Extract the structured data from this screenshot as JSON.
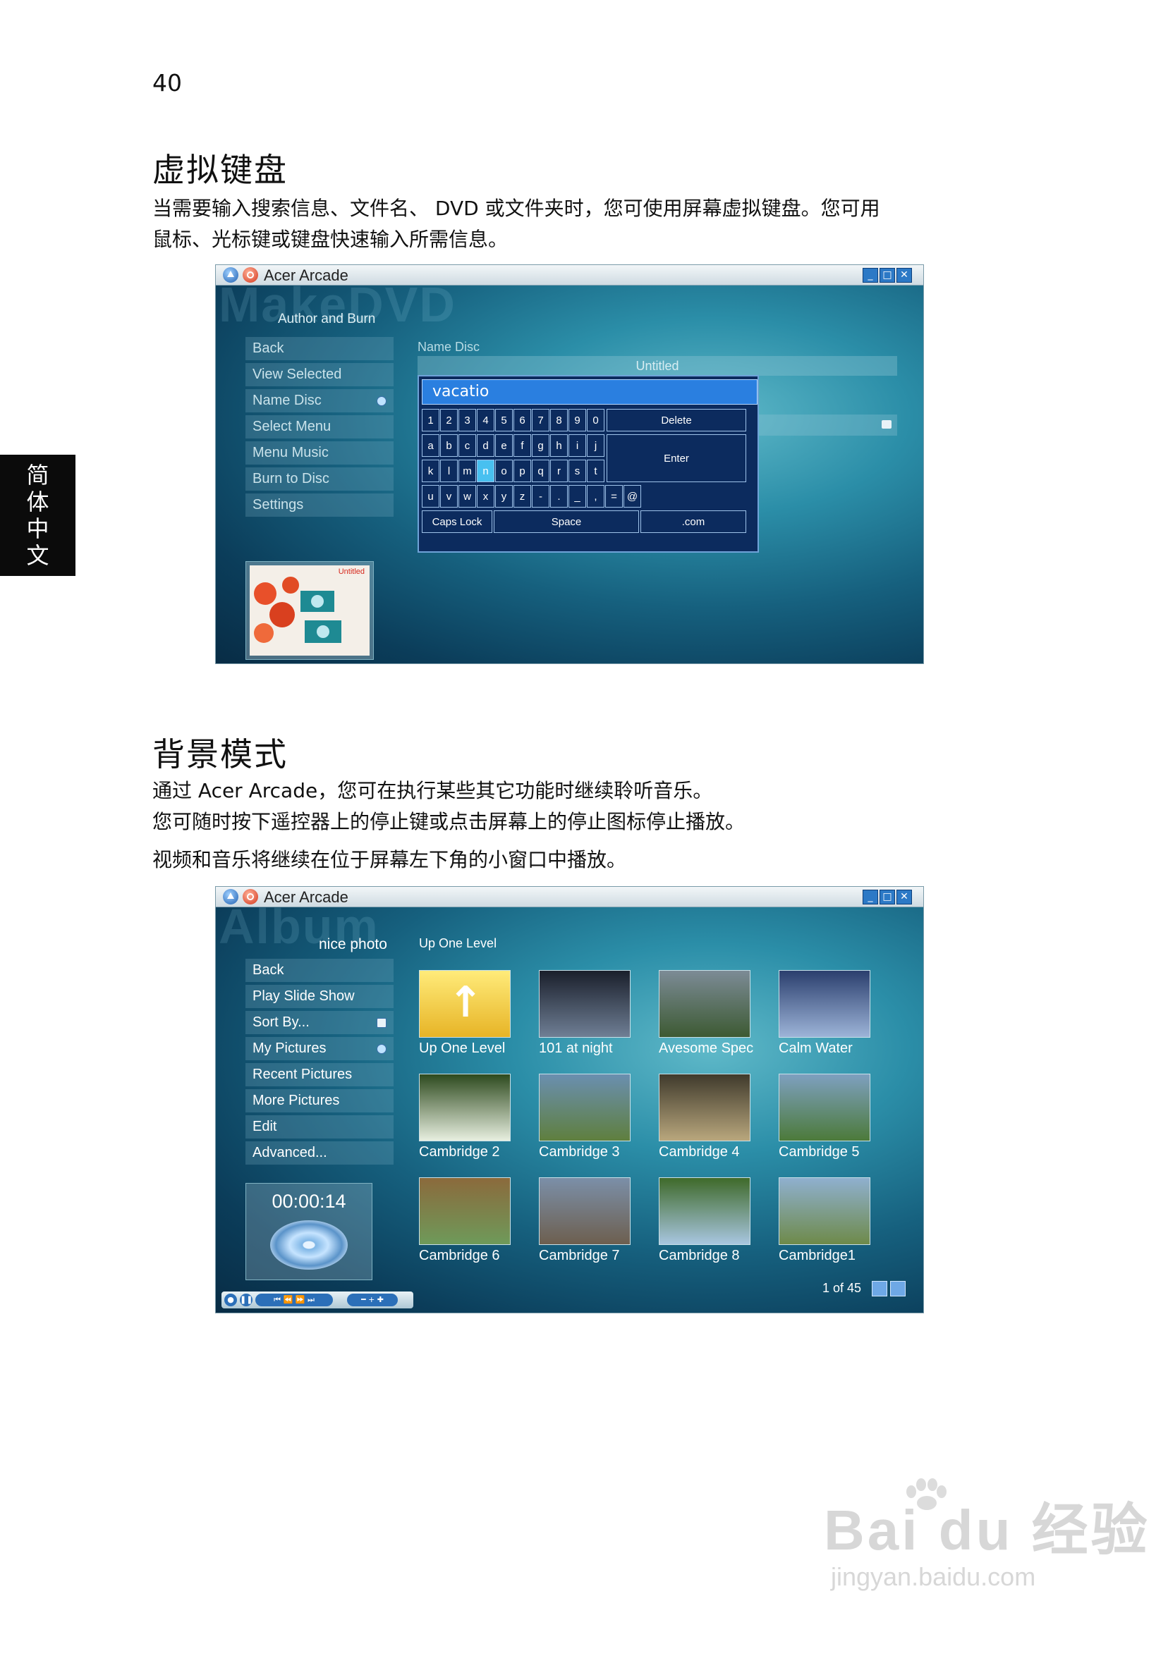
{
  "page_number": "40",
  "side_tab": "简体中文",
  "section1": {
    "heading": "虚拟键盘",
    "lines": [
      "当需要输入搜索信息、文件名、 DVD 或文件夹时，您可使用屏幕虚拟键盘。您可用",
      "鼠标、光标键或键盘快速输入所需信息。"
    ]
  },
  "section2": {
    "heading": "背景模式",
    "lines": [
      "通过 Acer Arcade，您可在执行某些其它功能时继续聆听音乐。",
      "您可随时按下遥控器上的停止键或点击屏幕上的停止图标停止播放。",
      "视频和音乐将继续在位于屏幕左下角的小窗口中播放。"
    ]
  },
  "screen1": {
    "app_title": "Acer Arcade",
    "watermark": "MakeDVD",
    "subtitle": "Author and Burn",
    "menu": [
      "Back",
      "View Selected",
      "Name Disc",
      "Select Menu",
      "Menu Music",
      "Burn to Disc",
      "Settings"
    ],
    "field_label": "Name Disc",
    "field_value": "Untitled",
    "keyboard": {
      "input_value": "vacatio",
      "row1": [
        "1",
        "2",
        "3",
        "4",
        "5",
        "6",
        "7",
        "8",
        "9",
        "0"
      ],
      "row2": [
        "a",
        "b",
        "c",
        "d",
        "e",
        "f",
        "g",
        "h",
        "i",
        "j"
      ],
      "row3": [
        "k",
        "l",
        "m",
        "n",
        "o",
        "p",
        "q",
        "r",
        "s",
        "t"
      ],
      "row4": [
        "u",
        "v",
        "w",
        "x",
        "y",
        "z",
        "-",
        ".",
        "_",
        ",",
        "=",
        "@"
      ],
      "delete": "Delete",
      "enter": "Enter",
      "caps_lock": "Caps Lock",
      "space": "Space",
      "dotcom": ".com",
      "selected_key": "n"
    },
    "preview_label": "Untitled"
  },
  "screen2": {
    "app_title": "Acer Arcade",
    "watermark": "Album",
    "subtitle": "nice photo",
    "location": "Up One Level",
    "menu": [
      "Back",
      "Play Slide Show",
      "Sort By...",
      "My Pictures",
      "Recent Pictures",
      "More Pictures",
      "Edit",
      "Advanced..."
    ],
    "thumbnails": [
      "Up One Level",
      "101 at night",
      "Avesome Spec",
      "Calm Water",
      "Cambridge 2",
      "Cambridge 3",
      "Cambridge 4",
      "Cambridge 5",
      "Cambridge 6",
      "Cambridge 7",
      "Cambridge 8",
      "Cambridge1"
    ],
    "timer": "00:00:14",
    "page_count": "1 of 45"
  },
  "watermark": {
    "brand": "Bai du 经验",
    "url": "jingyan.baidu.com"
  },
  "colors": {
    "window_bg": "#16607e",
    "keyboard_bg": "#0c2b5e",
    "input_bg": "#2a7fe0",
    "selected_key": "#48c0f0"
  }
}
